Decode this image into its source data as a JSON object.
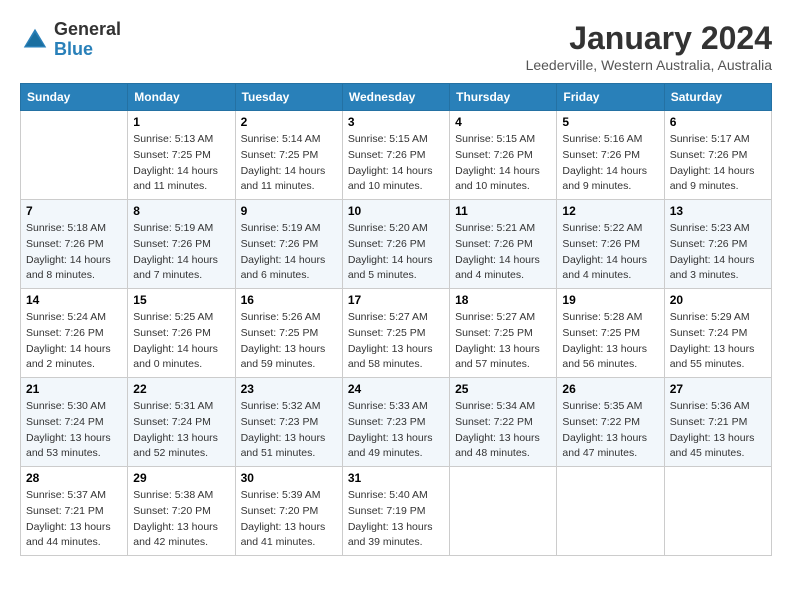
{
  "header": {
    "logo_general": "General",
    "logo_blue": "Blue",
    "month_title": "January 2024",
    "location": "Leederville, Western Australia, Australia"
  },
  "weekdays": [
    "Sunday",
    "Monday",
    "Tuesday",
    "Wednesday",
    "Thursday",
    "Friday",
    "Saturday"
  ],
  "weeks": [
    [
      {
        "day": "",
        "sunrise": "",
        "sunset": "",
        "daylight": ""
      },
      {
        "day": "1",
        "sunrise": "Sunrise: 5:13 AM",
        "sunset": "Sunset: 7:25 PM",
        "daylight": "Daylight: 14 hours and 11 minutes."
      },
      {
        "day": "2",
        "sunrise": "Sunrise: 5:14 AM",
        "sunset": "Sunset: 7:25 PM",
        "daylight": "Daylight: 14 hours and 11 minutes."
      },
      {
        "day": "3",
        "sunrise": "Sunrise: 5:15 AM",
        "sunset": "Sunset: 7:26 PM",
        "daylight": "Daylight: 14 hours and 10 minutes."
      },
      {
        "day": "4",
        "sunrise": "Sunrise: 5:15 AM",
        "sunset": "Sunset: 7:26 PM",
        "daylight": "Daylight: 14 hours and 10 minutes."
      },
      {
        "day": "5",
        "sunrise": "Sunrise: 5:16 AM",
        "sunset": "Sunset: 7:26 PM",
        "daylight": "Daylight: 14 hours and 9 minutes."
      },
      {
        "day": "6",
        "sunrise": "Sunrise: 5:17 AM",
        "sunset": "Sunset: 7:26 PM",
        "daylight": "Daylight: 14 hours and 9 minutes."
      }
    ],
    [
      {
        "day": "7",
        "sunrise": "Sunrise: 5:18 AM",
        "sunset": "Sunset: 7:26 PM",
        "daylight": "Daylight: 14 hours and 8 minutes."
      },
      {
        "day": "8",
        "sunrise": "Sunrise: 5:19 AM",
        "sunset": "Sunset: 7:26 PM",
        "daylight": "Daylight: 14 hours and 7 minutes."
      },
      {
        "day": "9",
        "sunrise": "Sunrise: 5:19 AM",
        "sunset": "Sunset: 7:26 PM",
        "daylight": "Daylight: 14 hours and 6 minutes."
      },
      {
        "day": "10",
        "sunrise": "Sunrise: 5:20 AM",
        "sunset": "Sunset: 7:26 PM",
        "daylight": "Daylight: 14 hours and 5 minutes."
      },
      {
        "day": "11",
        "sunrise": "Sunrise: 5:21 AM",
        "sunset": "Sunset: 7:26 PM",
        "daylight": "Daylight: 14 hours and 4 minutes."
      },
      {
        "day": "12",
        "sunrise": "Sunrise: 5:22 AM",
        "sunset": "Sunset: 7:26 PM",
        "daylight": "Daylight: 14 hours and 4 minutes."
      },
      {
        "day": "13",
        "sunrise": "Sunrise: 5:23 AM",
        "sunset": "Sunset: 7:26 PM",
        "daylight": "Daylight: 14 hours and 3 minutes."
      }
    ],
    [
      {
        "day": "14",
        "sunrise": "Sunrise: 5:24 AM",
        "sunset": "Sunset: 7:26 PM",
        "daylight": "Daylight: 14 hours and 2 minutes."
      },
      {
        "day": "15",
        "sunrise": "Sunrise: 5:25 AM",
        "sunset": "Sunset: 7:26 PM",
        "daylight": "Daylight: 14 hours and 0 minutes."
      },
      {
        "day": "16",
        "sunrise": "Sunrise: 5:26 AM",
        "sunset": "Sunset: 7:25 PM",
        "daylight": "Daylight: 13 hours and 59 minutes."
      },
      {
        "day": "17",
        "sunrise": "Sunrise: 5:27 AM",
        "sunset": "Sunset: 7:25 PM",
        "daylight": "Daylight: 13 hours and 58 minutes."
      },
      {
        "day": "18",
        "sunrise": "Sunrise: 5:27 AM",
        "sunset": "Sunset: 7:25 PM",
        "daylight": "Daylight: 13 hours and 57 minutes."
      },
      {
        "day": "19",
        "sunrise": "Sunrise: 5:28 AM",
        "sunset": "Sunset: 7:25 PM",
        "daylight": "Daylight: 13 hours and 56 minutes."
      },
      {
        "day": "20",
        "sunrise": "Sunrise: 5:29 AM",
        "sunset": "Sunset: 7:24 PM",
        "daylight": "Daylight: 13 hours and 55 minutes."
      }
    ],
    [
      {
        "day": "21",
        "sunrise": "Sunrise: 5:30 AM",
        "sunset": "Sunset: 7:24 PM",
        "daylight": "Daylight: 13 hours and 53 minutes."
      },
      {
        "day": "22",
        "sunrise": "Sunrise: 5:31 AM",
        "sunset": "Sunset: 7:24 PM",
        "daylight": "Daylight: 13 hours and 52 minutes."
      },
      {
        "day": "23",
        "sunrise": "Sunrise: 5:32 AM",
        "sunset": "Sunset: 7:23 PM",
        "daylight": "Daylight: 13 hours and 51 minutes."
      },
      {
        "day": "24",
        "sunrise": "Sunrise: 5:33 AM",
        "sunset": "Sunset: 7:23 PM",
        "daylight": "Daylight: 13 hours and 49 minutes."
      },
      {
        "day": "25",
        "sunrise": "Sunrise: 5:34 AM",
        "sunset": "Sunset: 7:22 PM",
        "daylight": "Daylight: 13 hours and 48 minutes."
      },
      {
        "day": "26",
        "sunrise": "Sunrise: 5:35 AM",
        "sunset": "Sunset: 7:22 PM",
        "daylight": "Daylight: 13 hours and 47 minutes."
      },
      {
        "day": "27",
        "sunrise": "Sunrise: 5:36 AM",
        "sunset": "Sunset: 7:21 PM",
        "daylight": "Daylight: 13 hours and 45 minutes."
      }
    ],
    [
      {
        "day": "28",
        "sunrise": "Sunrise: 5:37 AM",
        "sunset": "Sunset: 7:21 PM",
        "daylight": "Daylight: 13 hours and 44 minutes."
      },
      {
        "day": "29",
        "sunrise": "Sunrise: 5:38 AM",
        "sunset": "Sunset: 7:20 PM",
        "daylight": "Daylight: 13 hours and 42 minutes."
      },
      {
        "day": "30",
        "sunrise": "Sunrise: 5:39 AM",
        "sunset": "Sunset: 7:20 PM",
        "daylight": "Daylight: 13 hours and 41 minutes."
      },
      {
        "day": "31",
        "sunrise": "Sunrise: 5:40 AM",
        "sunset": "Sunset: 7:19 PM",
        "daylight": "Daylight: 13 hours and 39 minutes."
      },
      {
        "day": "",
        "sunrise": "",
        "sunset": "",
        "daylight": ""
      },
      {
        "day": "",
        "sunrise": "",
        "sunset": "",
        "daylight": ""
      },
      {
        "day": "",
        "sunrise": "",
        "sunset": "",
        "daylight": ""
      }
    ]
  ]
}
